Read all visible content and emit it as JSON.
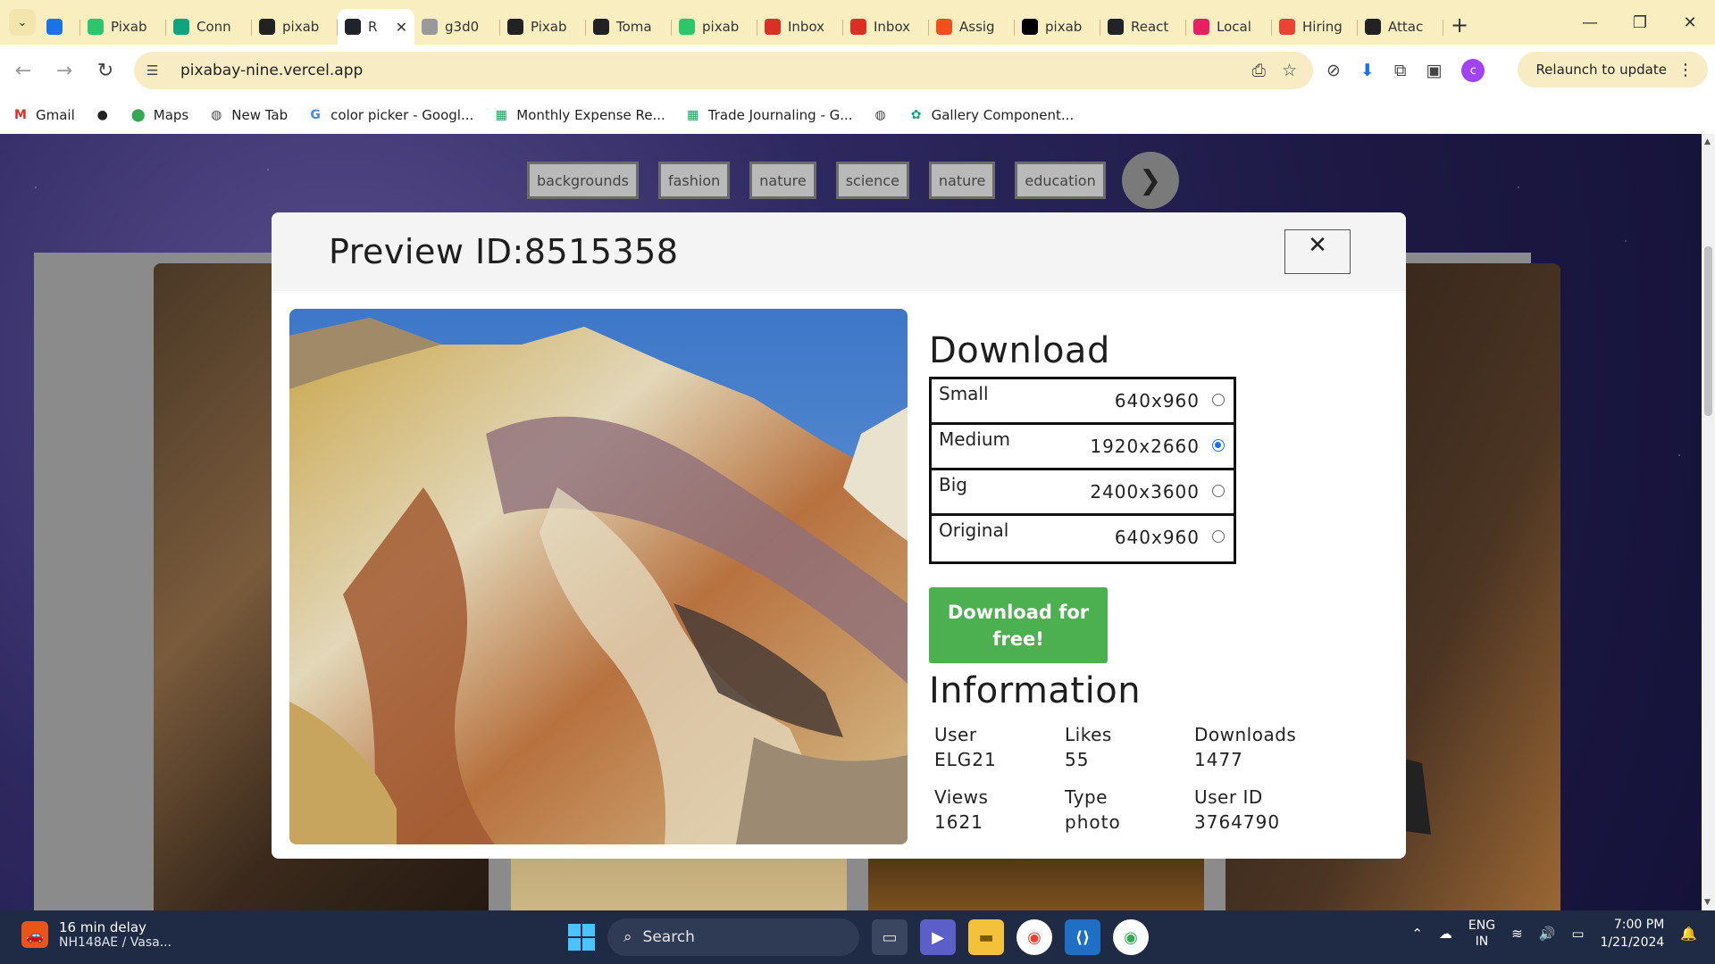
{
  "browser": {
    "tabs": [
      {
        "label": "",
        "favicon": "v-icon",
        "color": "#1a73e8"
      },
      {
        "label": "Pixab",
        "favicon": "px-icon",
        "color": "#2ec66d"
      },
      {
        "label": "Conn",
        "favicon": "chatgpt-icon",
        "color": "#10a37f"
      },
      {
        "label": "pixab",
        "favicon": "github-icon",
        "color": "#222222"
      },
      {
        "label": "R",
        "favicon": "react-icon",
        "color": "#20232a",
        "active": true
      },
      {
        "label": "g3d0",
        "favicon": "globe-icon",
        "color": "#999999"
      },
      {
        "label": "Pixab",
        "favicon": "github-icon",
        "color": "#222222"
      },
      {
        "label": "Toma",
        "favicon": "github-icon",
        "color": "#222222"
      },
      {
        "label": "pixab",
        "favicon": "px-icon",
        "color": "#2ec66d"
      },
      {
        "label": "Inbox",
        "favicon": "gmail-icon",
        "color": "#d93025"
      },
      {
        "label": "Inbox",
        "favicon": "gmail-icon",
        "color": "#d93025"
      },
      {
        "label": "Assig",
        "favicon": "figma-icon",
        "color": "#f24e1e"
      },
      {
        "label": "pixab",
        "favicon": "vercel-icon",
        "color": "#000000"
      },
      {
        "label": "React",
        "favicon": "react-icon",
        "color": "#20232a"
      },
      {
        "label": "Local",
        "favicon": "localhost-icon",
        "color": "#e91e63"
      },
      {
        "label": "Hiring",
        "favicon": "rocket-icon",
        "color": "#ea4335"
      },
      {
        "label": "Attac",
        "favicon": "github-icon",
        "color": "#222222"
      }
    ],
    "url": "pixabay-nine.vercel.app",
    "relaunch_label": "Relaunch to update",
    "profile_initial": "c",
    "bookmarks": [
      {
        "label": "Gmail",
        "icon": "gmail-icon"
      },
      {
        "label": "",
        "icon": "github-icon"
      },
      {
        "label": "Maps",
        "icon": "maps-icon"
      },
      {
        "label": "New Tab",
        "icon": "globe-icon"
      },
      {
        "label": "color picker - Googl...",
        "icon": "google-icon"
      },
      {
        "label": "Monthly Expense Re...",
        "icon": "sheets-icon"
      },
      {
        "label": "Trade Journaling - G...",
        "icon": "sheets-icon"
      },
      {
        "label": "",
        "icon": "globe-icon"
      },
      {
        "label": "Gallery Component...",
        "icon": "chatgpt-icon"
      }
    ]
  },
  "page": {
    "tags": [
      "backgrounds",
      "fashion",
      "nature",
      "science",
      "nature",
      "education"
    ],
    "next_glyph": "❯"
  },
  "modal": {
    "title": "Preview ID:8515358",
    "close_glyph": "✕",
    "download_heading": "Download",
    "sizes": [
      {
        "name": "Small",
        "dim": "640x960",
        "selected": false
      },
      {
        "name": "Medium",
        "dim": "1920x2660",
        "selected": true
      },
      {
        "name": "Big",
        "dim": "2400x3600",
        "selected": false
      },
      {
        "name": "Original",
        "dim": "640x960",
        "selected": false
      }
    ],
    "download_button": "Download for free!",
    "info_heading": "Information",
    "info": [
      {
        "label": "User",
        "value": "ELG21"
      },
      {
        "label": "Likes",
        "value": "55"
      },
      {
        "label": "Downloads",
        "value": "1477"
      },
      {
        "label": "Views",
        "value": "1621"
      },
      {
        "label": "Type",
        "value": "photo"
      },
      {
        "label": "User ID",
        "value": "3764790"
      }
    ]
  },
  "taskbar": {
    "weather_title": "16 min delay",
    "weather_sub": "NH148AE / Vasa...",
    "search_placeholder": "Search",
    "lang_top": "ENG",
    "lang_bottom": "IN",
    "time": "7:00 PM",
    "date": "1/21/2024"
  }
}
